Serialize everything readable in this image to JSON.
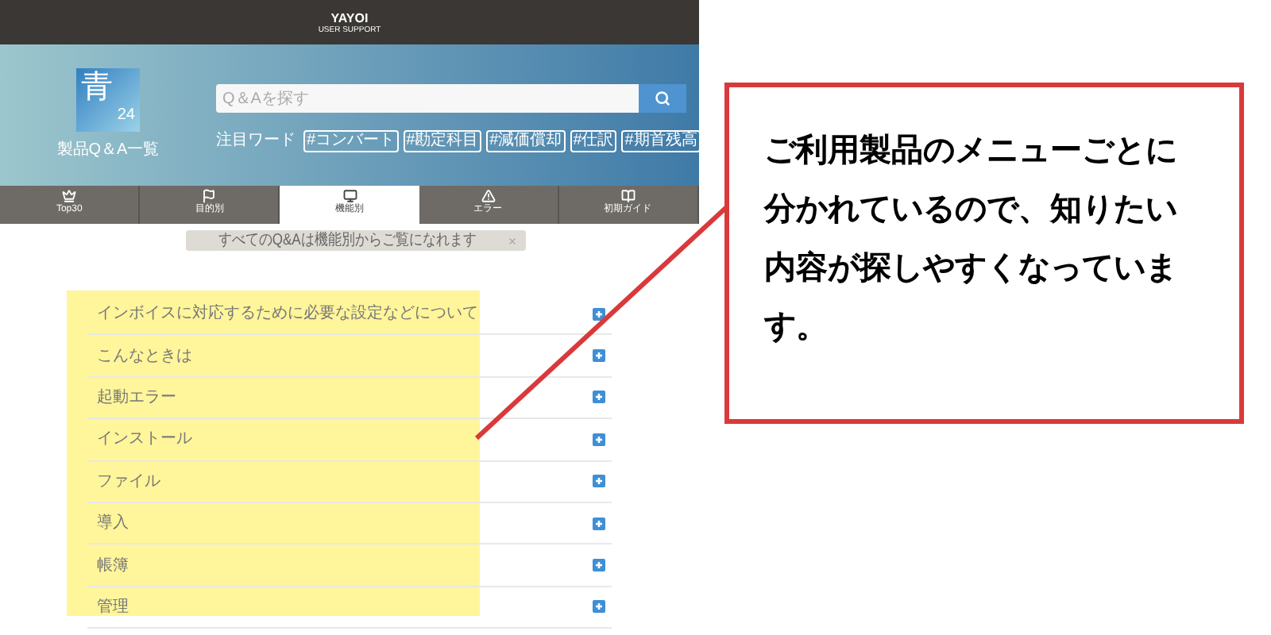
{
  "header": {
    "logo_line_1": "YAYOI",
    "logo_line_2": "USER SUPPORT"
  },
  "hero": {
    "product_icon": {
      "main": "青",
      "sub": "24"
    },
    "product_title": "製品Q＆A一覧",
    "search": {
      "placeholder": "Q＆Aを探す"
    },
    "hot_words_label": "注目ワード",
    "hot_words": [
      "#コンバート",
      "#勘定科目",
      "#減価償却",
      "#仕訳",
      "#期首残高"
    ]
  },
  "tabs": [
    {
      "label": "Top30",
      "selected": false
    },
    {
      "label": "目的別",
      "selected": false
    },
    {
      "label": "機能別",
      "selected": true
    },
    {
      "label": "エラー",
      "selected": false
    },
    {
      "label": "初期ガイド",
      "selected": false
    }
  ],
  "tooltip": {
    "text": "すべてのQ&Aは機能別からご覧になれます",
    "close": "×"
  },
  "categories": [
    "インボイスに対応するために必要な設定などについて",
    "こんなときは",
    "起動エラー",
    "インストール",
    "ファイル",
    "導入",
    "帳簿",
    "管理"
  ],
  "callout": {
    "text": "ご利用製品のメニューごとに分かれているので、知りたい内容が探しやすくなっています。"
  }
}
